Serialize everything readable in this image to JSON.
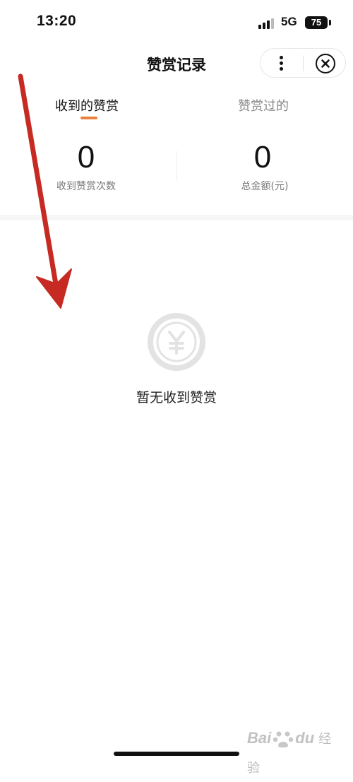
{
  "status_bar": {
    "time": "13:20",
    "network": "5G",
    "battery": "75"
  },
  "nav": {
    "title": "赞赏记录",
    "icons": [
      "more-dots-icon",
      "close-circle-icon"
    ]
  },
  "tabs": [
    {
      "label": "收到的赞赏",
      "active": true
    },
    {
      "label": "赞赏过的",
      "active": false
    }
  ],
  "stats": {
    "count_value": "0",
    "count_label": "收到赞赏次数",
    "amount_value": "0",
    "amount_label": "总金额(元)"
  },
  "empty_state": {
    "icon": "yen-coin-icon",
    "text": "暂无收到赞赏"
  },
  "watermark": {
    "brand": "Bai",
    "brand_suffix": "du",
    "sub": "经验"
  },
  "colors": {
    "accent": "#e8823c",
    "annotation_arrow": "#c62a22",
    "empty_icon": "#e3e3e3"
  }
}
